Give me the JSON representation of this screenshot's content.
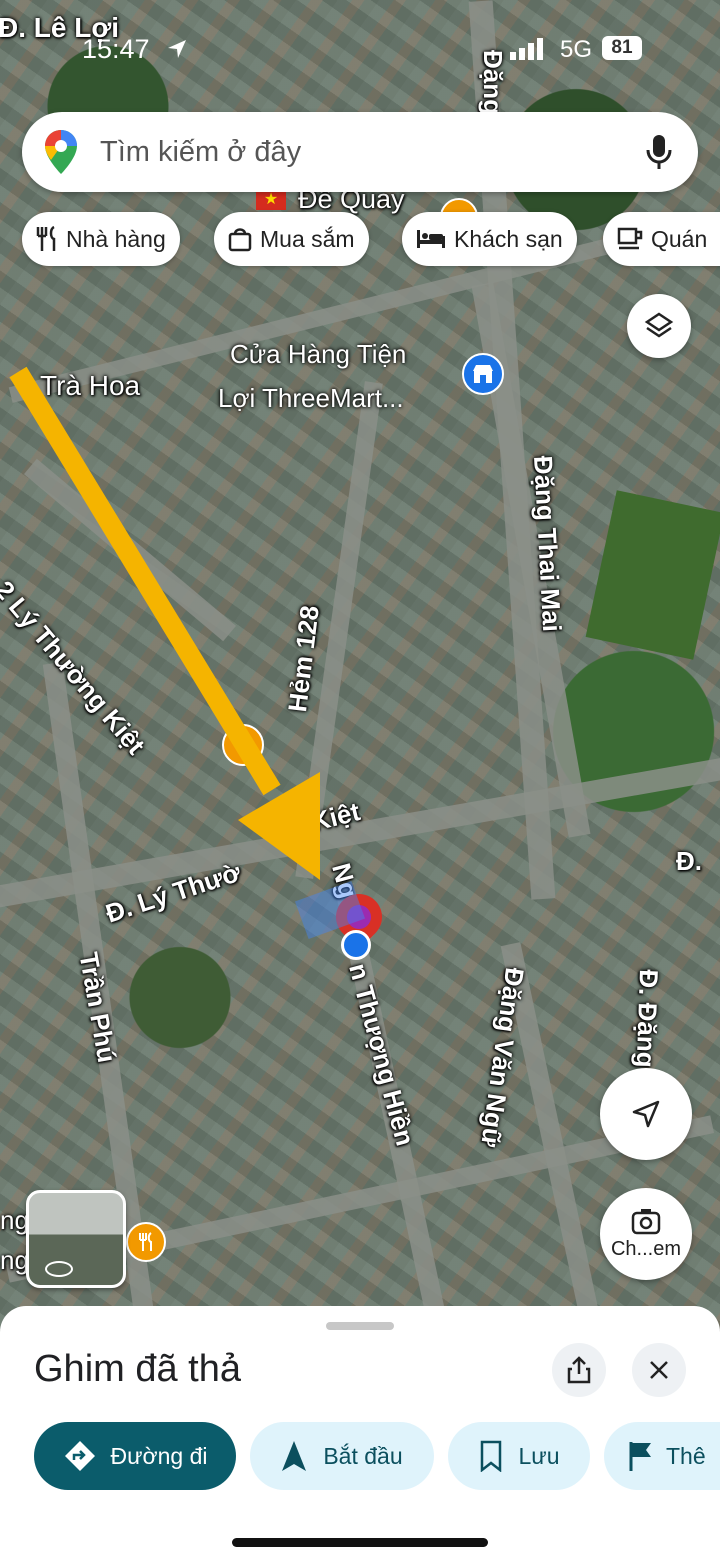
{
  "status_bar": {
    "time": "15:47",
    "network": "5G",
    "battery": "81"
  },
  "search": {
    "placeholder": "Tìm kiếm ở đây"
  },
  "chips": [
    {
      "label": "Nhà hàng",
      "icon": "fork-knife-icon"
    },
    {
      "label": "Mua sắm",
      "icon": "shopping-bag-icon"
    },
    {
      "label": "Khách sạn",
      "icon": "bed-icon"
    },
    {
      "label": "Quán",
      "icon": "coffee-cup-icon"
    }
  ],
  "map": {
    "roads": {
      "le_loi": "Đ. Lê Lợi",
      "dang_top": "Đặng",
      "tra_hoa": "Trà Hoa",
      "dang_thai_mai": "Đặng Thai Mai",
      "hem_128": "Hẻm 128",
      "ly_thuong_kiet_diag": "2 Lý Thường Kiệt",
      "ly_thuong_kiet": "Đ. Lý Thườ",
      "kiet": "Kiệt",
      "tran_phu": "Trần Phú",
      "nguyen_thuong_hien": "n Thượng Hiền",
      "nguyen_prefix": "Ng",
      "dang_van_ngu": "Đặng Văn Ngữ",
      "d_dang_right": "Đ. Đặng",
      "d_right": "Đ.",
      "de_quay": "Đề Quay",
      "ng_left": "ng",
      "ng_left2": "ng"
    },
    "poi": {
      "line1": "Cửa Hàng Tiện",
      "line2": "Lợi ThreeMart..."
    },
    "street_view_label": "Ch...em"
  },
  "sheet": {
    "title": "Ghim đã thả",
    "actions": [
      {
        "label": "Đường đi",
        "icon": "directions-icon"
      },
      {
        "label": "Bắt đầu",
        "icon": "navigation-arrow-icon"
      },
      {
        "label": "Lưu",
        "icon": "bookmark-icon"
      },
      {
        "label": "Thê",
        "icon": "flag-icon"
      }
    ]
  },
  "colors": {
    "accent": "#0b5c6b",
    "chip_bg": "#dff3fb",
    "arrow": "#f5b400",
    "pin": "#d93025",
    "location": "#1a73e8"
  }
}
